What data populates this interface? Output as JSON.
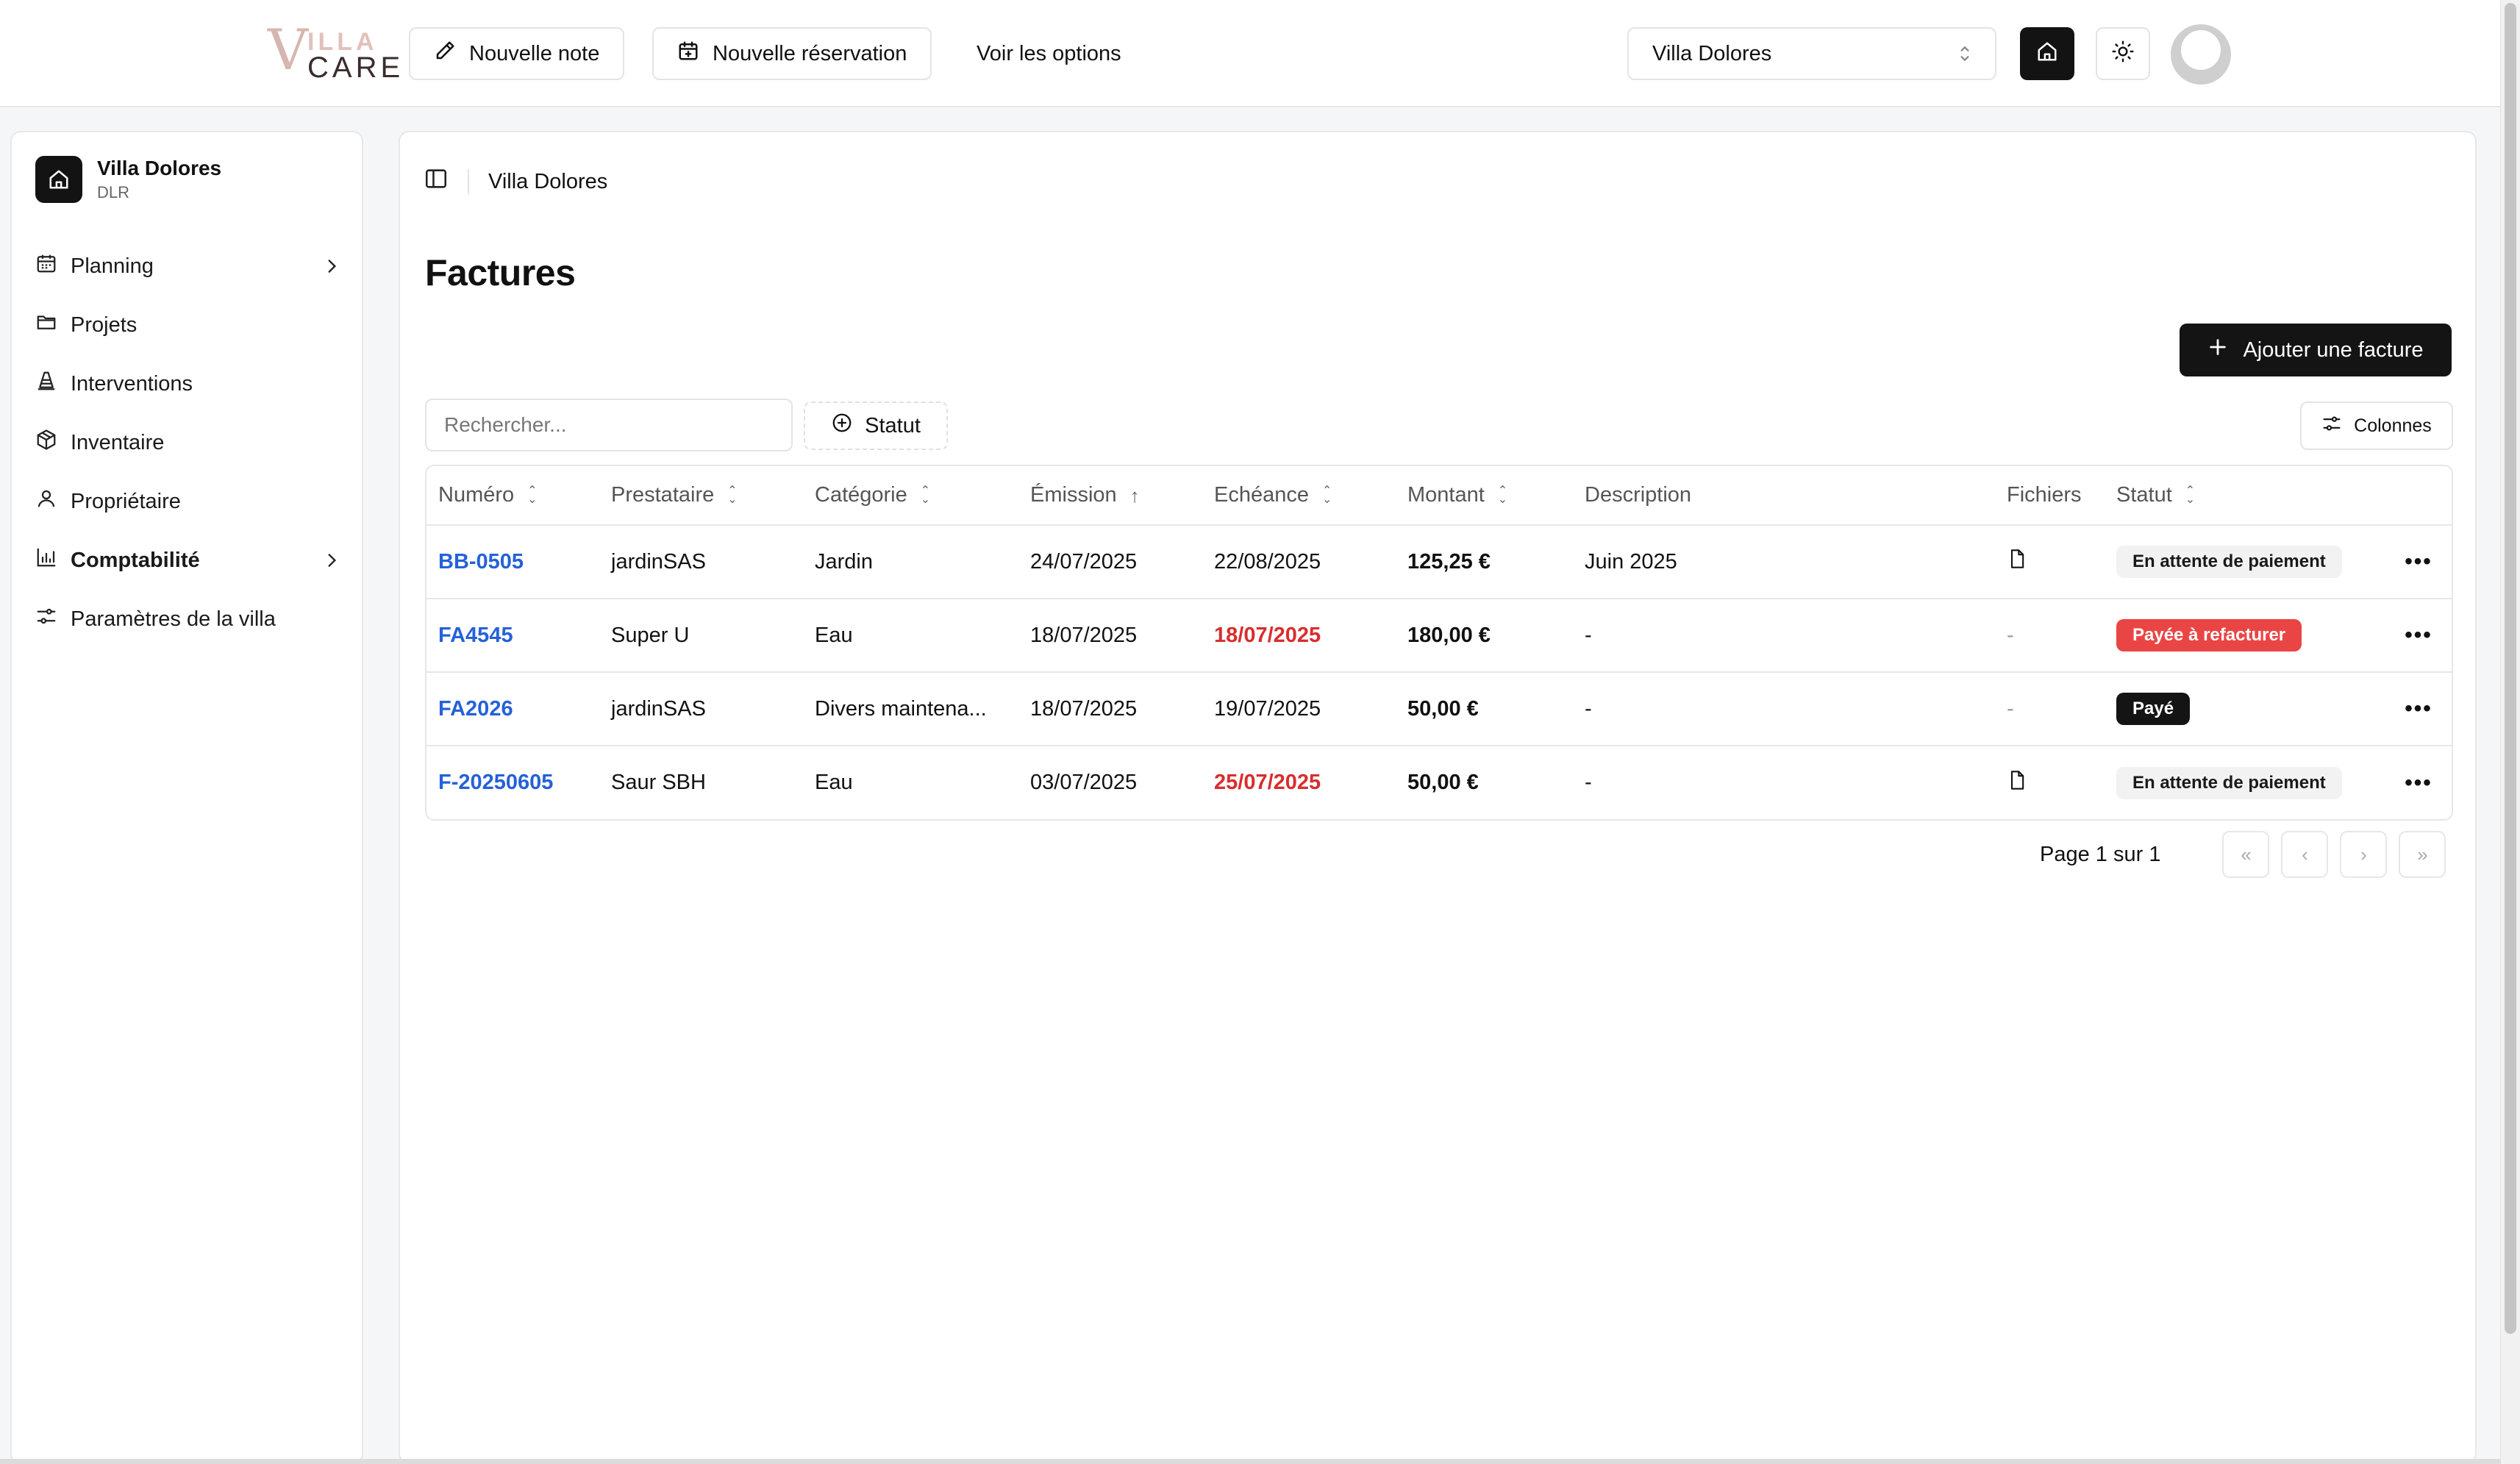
{
  "brand": {
    "v": "V",
    "illa": "ILLA",
    "care": "CARE"
  },
  "topbar": {
    "new_note": "Nouvelle note",
    "new_reservation": "Nouvelle réservation",
    "options": "Voir les options",
    "villa_select": "Villa Dolores"
  },
  "sidebar": {
    "villa_name": "Villa Dolores",
    "villa_code": "DLR",
    "items": [
      {
        "label": "Planning",
        "icon": "calendar-icon"
      },
      {
        "label": "Projets",
        "icon": "folder-icon"
      },
      {
        "label": "Interventions",
        "icon": "cone-icon"
      },
      {
        "label": "Inventaire",
        "icon": "package-icon"
      },
      {
        "label": "Propriétaire",
        "icon": "user-icon"
      },
      {
        "label": "Comptabilité",
        "icon": "bar-chart-icon"
      },
      {
        "label": "Paramètres de la villa",
        "icon": "settings-sliders-icon"
      }
    ]
  },
  "breadcrumb": {
    "current": "Villa Dolores"
  },
  "page": {
    "title": "Factures",
    "add_button": "Ajouter une facture",
    "search_placeholder": "Rechercher...",
    "status_filter": "Statut",
    "columns_button": "Colonnes"
  },
  "table": {
    "headers": [
      "Numéro",
      "Prestataire",
      "Catégorie",
      "Émission",
      "Echéance",
      "Montant",
      "Description",
      "Fichiers",
      "Statut"
    ],
    "rows": [
      {
        "numero": "BB-0505",
        "prestataire": "jardinSAS",
        "categorie": "Jardin",
        "emission": "24/07/2025",
        "echeance": "22/08/2025",
        "montant": "125,25 €",
        "description": "Juin 2025",
        "fichiers": "",
        "statut": "En attente de paiement"
      },
      {
        "numero": "FA4545",
        "prestataire": "Super U",
        "categorie": "Eau",
        "emission": "18/07/2025",
        "echeance": "18/07/2025",
        "montant": "180,00 €",
        "description": "-",
        "fichiers": "-",
        "statut": "Payée à refacturer"
      },
      {
        "numero": "FA2026",
        "prestataire": "jardinSAS",
        "categorie": "Divers maintena...",
        "emission": "18/07/2025",
        "echeance": "19/07/2025",
        "montant": "50,00 €",
        "description": "-",
        "fichiers": "-",
        "statut": "Payé"
      },
      {
        "numero": "F-20250605",
        "prestataire": "Saur SBH",
        "categorie": "Eau",
        "emission": "03/07/2025",
        "echeance": "25/07/2025",
        "montant": "50,00 €",
        "description": "-",
        "fichiers": "",
        "statut": "En attente de paiement"
      }
    ]
  },
  "pagination": {
    "text": "Page 1 sur 1"
  },
  "colors": {
    "accent": "#141414",
    "link": "#2561d9",
    "overdue": "#d92d2d",
    "badge_refacturer": "#ea4545"
  }
}
